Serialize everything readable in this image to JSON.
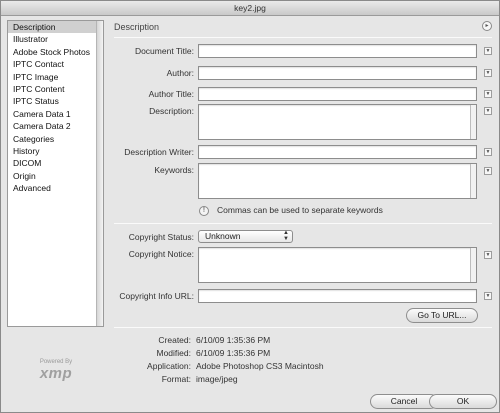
{
  "window": {
    "title": "key2.jpg"
  },
  "sidebar": {
    "items": [
      {
        "label": "Description"
      },
      {
        "label": "Illustrator"
      },
      {
        "label": "Adobe Stock Photos"
      },
      {
        "label": "IPTC Contact"
      },
      {
        "label": "IPTC Image"
      },
      {
        "label": "IPTC Content"
      },
      {
        "label": "IPTC Status"
      },
      {
        "label": "Camera Data 1"
      },
      {
        "label": "Camera Data 2"
      },
      {
        "label": "Categories"
      },
      {
        "label": "History"
      },
      {
        "label": "DICOM"
      },
      {
        "label": "Origin"
      },
      {
        "label": "Advanced"
      }
    ],
    "logo": {
      "small": "Powered By",
      "big": "xmp"
    }
  },
  "section": {
    "title": "Description"
  },
  "fields": {
    "document_title": {
      "label": "Document Title:",
      "value": ""
    },
    "author": {
      "label": "Author:",
      "value": ""
    },
    "author_title": {
      "label": "Author Title:",
      "value": ""
    },
    "description": {
      "label": "Description:",
      "value": ""
    },
    "description_writer": {
      "label": "Description Writer:",
      "value": ""
    },
    "keywords": {
      "label": "Keywords:",
      "value": ""
    },
    "keywords_hint": "Commas can be used to separate keywords",
    "copyright_status": {
      "label": "Copyright Status:",
      "value": "Unknown"
    },
    "copyright_notice": {
      "label": "Copyright Notice:",
      "value": ""
    },
    "copyright_url": {
      "label": "Copyright Info URL:",
      "value": ""
    }
  },
  "buttons": {
    "go_to_url": "Go To URL...",
    "cancel": "Cancel",
    "ok": "OK"
  },
  "metadata": {
    "created": {
      "label": "Created:",
      "value": "6/10/09 1:35:36 PM"
    },
    "modified": {
      "label": "Modified:",
      "value": "6/10/09 1:35:36 PM"
    },
    "application": {
      "label": "Application:",
      "value": "Adobe Photoshop CS3 Macintosh"
    },
    "format": {
      "label": "Format:",
      "value": "image/jpeg"
    }
  },
  "icons": {
    "menu": "triangle-down-icon",
    "info": "info-icon",
    "select": "up-down-arrows-icon",
    "section_menu": "circle-arrow-icon"
  }
}
